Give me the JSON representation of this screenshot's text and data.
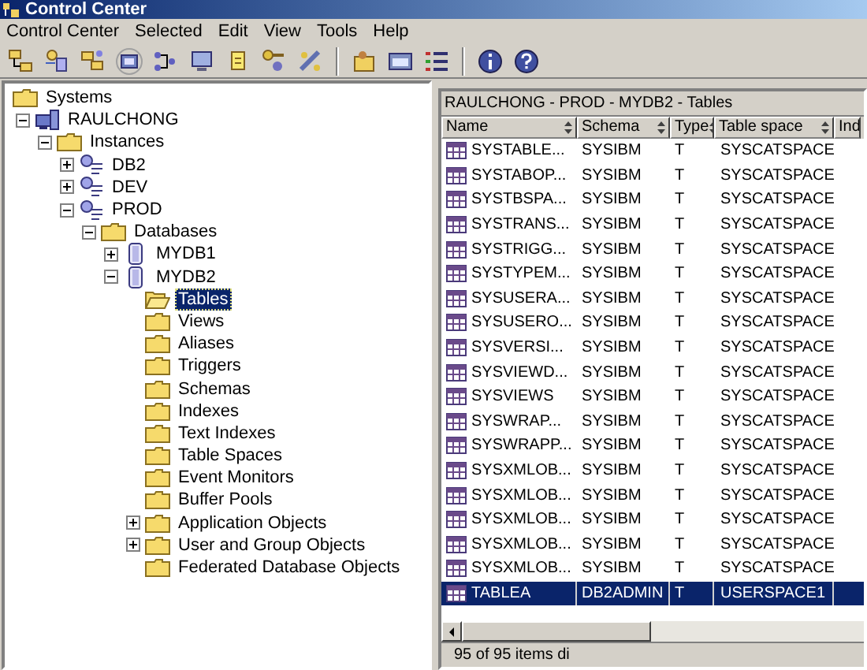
{
  "window": {
    "title": "Control Center"
  },
  "menu": [
    {
      "label": "Control Center"
    },
    {
      "label": "Selected"
    },
    {
      "label": "Edit"
    },
    {
      "label": "View"
    },
    {
      "label": "Tools"
    },
    {
      "label": "Help"
    }
  ],
  "tree": [
    {
      "label": "Systems",
      "kind": "folder",
      "selected": false,
      "children": [
        {
          "label": "RAULCHONG",
          "kind": "system",
          "expanded": true,
          "selected": false,
          "children": [
            {
              "label": "Instances",
              "kind": "folder",
              "expanded": true,
              "selected": false,
              "children": [
                {
                  "label": "DB2",
                  "kind": "instance",
                  "expanded": false,
                  "selected": false
                },
                {
                  "label": "DEV",
                  "kind": "instance",
                  "expanded": false,
                  "selected": false
                },
                {
                  "label": "PROD",
                  "kind": "instance",
                  "expanded": true,
                  "selected": false,
                  "children": [
                    {
                      "label": "Databases",
                      "kind": "folder",
                      "expanded": true,
                      "selected": false,
                      "children": [
                        {
                          "label": "MYDB1",
                          "kind": "database",
                          "expanded": false,
                          "selected": false
                        },
                        {
                          "label": "MYDB2",
                          "kind": "database",
                          "expanded": true,
                          "selected": false,
                          "children": [
                            {
                              "label": "Tables",
                              "kind": "openfolder",
                              "selected": true
                            },
                            {
                              "label": "Views",
                              "kind": "folder",
                              "selected": false
                            },
                            {
                              "label": "Aliases",
                              "kind": "folder",
                              "selected": false
                            },
                            {
                              "label": "Triggers",
                              "kind": "folder",
                              "selected": false
                            },
                            {
                              "label": "Schemas",
                              "kind": "folder",
                              "selected": false
                            },
                            {
                              "label": "Indexes",
                              "kind": "folder",
                              "selected": false
                            },
                            {
                              "label": "Text Indexes",
                              "kind": "folder",
                              "selected": false
                            },
                            {
                              "label": "Table Spaces",
                              "kind": "folder",
                              "selected": false
                            },
                            {
                              "label": "Event Monitors",
                              "kind": "folder",
                              "selected": false
                            },
                            {
                              "label": "Buffer Pools",
                              "kind": "folder",
                              "selected": false
                            },
                            {
                              "label": "Application Objects",
                              "kind": "folder",
                              "expanded": false,
                              "selected": false
                            },
                            {
                              "label": "User and Group Objects",
                              "kind": "folder",
                              "expanded": false,
                              "selected": false
                            },
                            {
                              "label": "Federated Database Objects",
                              "kind": "folder",
                              "selected": false
                            }
                          ]
                        }
                      ]
                    }
                  ]
                }
              ]
            }
          ]
        }
      ]
    }
  ],
  "contents": {
    "path": "RAULCHONG - PROD - MYDB2 - Tables",
    "columns": [
      "Name",
      "Schema",
      "Type",
      "Table space",
      "Ind"
    ],
    "rows": [
      {
        "cells": [
          "SYSTABLE...",
          "SYSIBM",
          "T",
          "SYSCATSPACE"
        ],
        "selected": false
      },
      {
        "cells": [
          "SYSTABOP...",
          "SYSIBM",
          "T",
          "SYSCATSPACE"
        ],
        "selected": false
      },
      {
        "cells": [
          "SYSTBSPA...",
          "SYSIBM",
          "T",
          "SYSCATSPACE"
        ],
        "selected": false
      },
      {
        "cells": [
          "SYSTRANS...",
          "SYSIBM",
          "T",
          "SYSCATSPACE"
        ],
        "selected": false
      },
      {
        "cells": [
          "SYSTRIGG...",
          "SYSIBM",
          "T",
          "SYSCATSPACE"
        ],
        "selected": false
      },
      {
        "cells": [
          "SYSTYPEM...",
          "SYSIBM",
          "T",
          "SYSCATSPACE"
        ],
        "selected": false
      },
      {
        "cells": [
          "SYSUSERA...",
          "SYSIBM",
          "T",
          "SYSCATSPACE"
        ],
        "selected": false
      },
      {
        "cells": [
          "SYSUSERO...",
          "SYSIBM",
          "T",
          "SYSCATSPACE"
        ],
        "selected": false
      },
      {
        "cells": [
          "SYSVERSI...",
          "SYSIBM",
          "T",
          "SYSCATSPACE"
        ],
        "selected": false
      },
      {
        "cells": [
          "SYSVIEWD...",
          "SYSIBM",
          "T",
          "SYSCATSPACE"
        ],
        "selected": false
      },
      {
        "cells": [
          "SYSVIEWS",
          "SYSIBM",
          "T",
          "SYSCATSPACE"
        ],
        "selected": false
      },
      {
        "cells": [
          "SYSWRAP...",
          "SYSIBM",
          "T",
          "SYSCATSPACE"
        ],
        "selected": false
      },
      {
        "cells": [
          "SYSWRAPP...",
          "SYSIBM",
          "T",
          "SYSCATSPACE"
        ],
        "selected": false
      },
      {
        "cells": [
          "SYSXMLOB...",
          "SYSIBM",
          "T",
          "SYSCATSPACE"
        ],
        "selected": false
      },
      {
        "cells": [
          "SYSXMLOB...",
          "SYSIBM",
          "T",
          "SYSCATSPACE"
        ],
        "selected": false
      },
      {
        "cells": [
          "SYSXMLOB...",
          "SYSIBM",
          "T",
          "SYSCATSPACE"
        ],
        "selected": false
      },
      {
        "cells": [
          "SYSXMLOB...",
          "SYSIBM",
          "T",
          "SYSCATSPACE"
        ],
        "selected": false
      },
      {
        "cells": [
          "SYSXMLOB...",
          "SYSIBM",
          "T",
          "SYSCATSPACE"
        ],
        "selected": false
      },
      {
        "cells": [
          "TABLEA",
          "DB2ADMIN",
          "T",
          "USERSPACE1"
        ],
        "selected": true
      }
    ],
    "status": "95 of 95 items di"
  }
}
